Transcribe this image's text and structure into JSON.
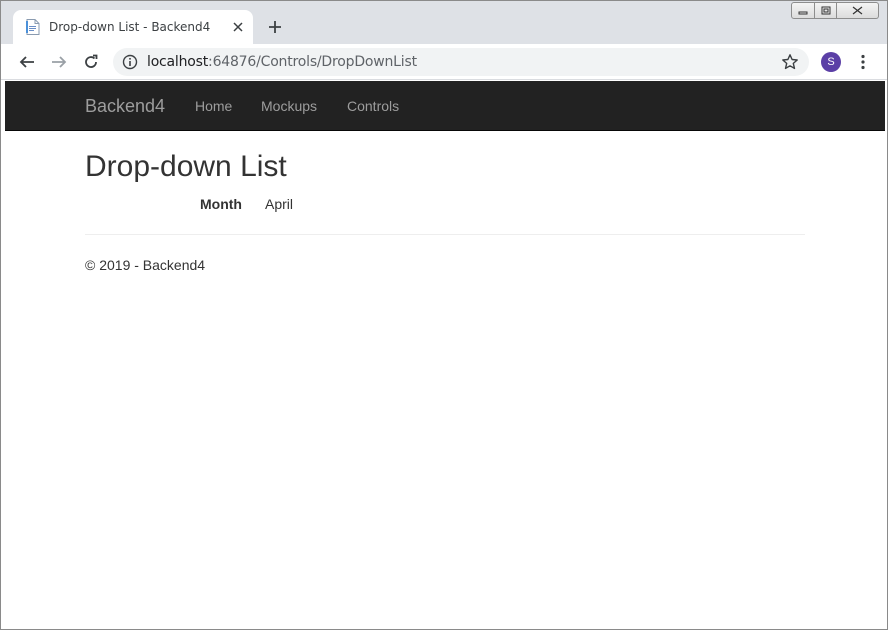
{
  "browser": {
    "tab_title": "Drop-down List - Backend4",
    "url_host": "localhost",
    "url_rest": ":64876/Controls/DropDownList",
    "profile_initial": "S"
  },
  "navbar": {
    "brand": "Backend4",
    "links": [
      "Home",
      "Mockups",
      "Controls"
    ]
  },
  "page": {
    "title": "Drop-down List",
    "field_label": "Month",
    "field_value": "April",
    "footer": "© 2019 - Backend4"
  },
  "colors": {
    "navbar_bg": "#222222",
    "navbar_text": "#9d9d9d",
    "avatar": "#5b3fa6"
  }
}
